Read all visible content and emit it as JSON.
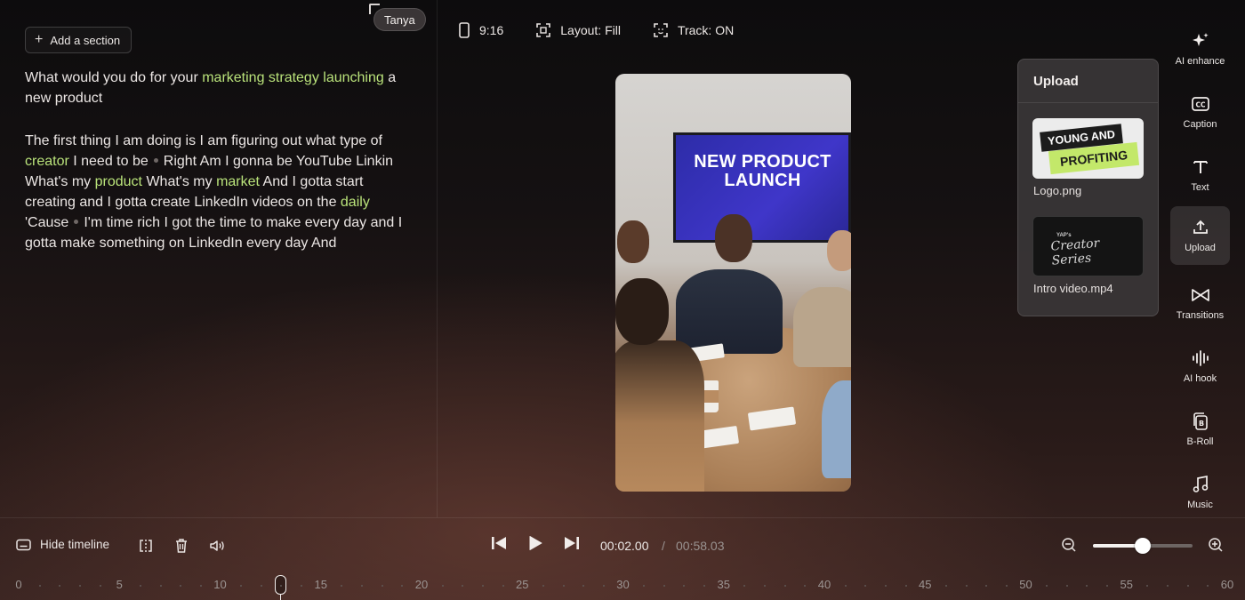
{
  "editor": {
    "add_section_label": "Add a section",
    "speaker_tag": "Tanya",
    "transcript": {
      "p1": {
        "t1": "What would you do for your ",
        "h1": "marketing strategy launching",
        "t2": " a new product"
      },
      "p2": {
        "t1": "The first thing I am doing is I am figuring out what type of ",
        "h1": "creator",
        "t2": " I need to be",
        "t3": "Right Am I gonna be YouTube Linkin What's my ",
        "h2": "product",
        "t4": " What's my ",
        "h3": "market",
        "t5": " And I gotta start creating and I gotta create LinkedIn videos on the ",
        "h4": "daily",
        "t6": " 'Cause",
        "t7": "I'm time rich I got the time to make every day and I gotta make something on LinkedIn every day And"
      }
    }
  },
  "toolbar": {
    "aspect_label": "9:16",
    "layout_label": "Layout: Fill",
    "track_label": "Track: ON"
  },
  "preview": {
    "screen_text_line1": "NEW PRODUCT",
    "screen_text_line2": "LAUNCH"
  },
  "upload_panel": {
    "title": "Upload",
    "items": [
      {
        "name": "Logo.png",
        "logo_line1": "YOUNG AND",
        "logo_line2": "PROFITING"
      },
      {
        "name": "Intro video.mp4",
        "logo_small": "YAP's",
        "logo_script": "Creator Series"
      }
    ]
  },
  "sidebar": {
    "items": [
      {
        "label": "AI enhance",
        "icon": "sparkle-icon"
      },
      {
        "label": "Caption",
        "icon": "cc-icon"
      },
      {
        "label": "Text",
        "icon": "text-icon"
      },
      {
        "label": "Upload",
        "icon": "upload-icon",
        "active": true
      },
      {
        "label": "Transitions",
        "icon": "transitions-icon"
      },
      {
        "label": "AI hook",
        "icon": "waveform-icon"
      },
      {
        "label": "B-Roll",
        "icon": "broll-icon"
      },
      {
        "label": "Music",
        "icon": "music-note-icon"
      }
    ]
  },
  "timeline": {
    "hide_label": "Hide timeline",
    "current_time": "00:02.00",
    "separator": "/",
    "total_time": "00:58.03",
    "zoom_level": 0.5,
    "playhead_seconds": 13,
    "ticks": [
      "0",
      "5",
      "10",
      "15",
      "20",
      "25",
      "30",
      "35",
      "40",
      "45",
      "50",
      "55",
      "60"
    ]
  },
  "colors": {
    "highlight": "#b9e27a",
    "accent_logo": "#c3e86a",
    "tv_screen": "#3f36c9"
  }
}
